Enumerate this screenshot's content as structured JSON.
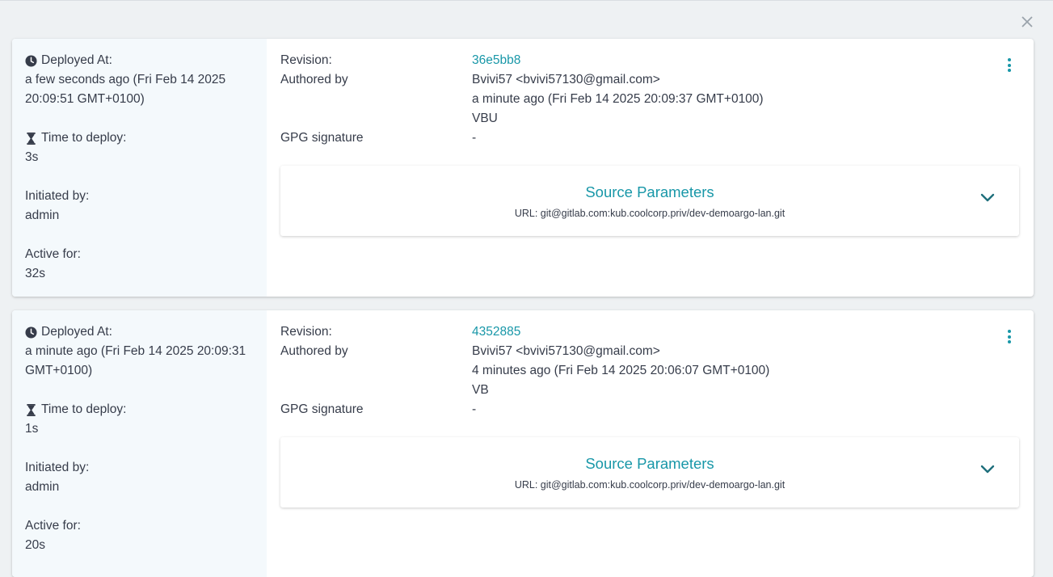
{
  "dialog": {
    "close_icon": "close-icon"
  },
  "labels": {
    "deployed_at": "Deployed At:",
    "time_to_deploy": "Time to deploy:",
    "initiated_by": "Initiated by:",
    "active_for": "Active for:",
    "revision": "Revision:",
    "authored_by": "Authored by",
    "gpg_signature": "GPG signature",
    "source_parameters": "Source Parameters"
  },
  "deployments": [
    {
      "deployed_at_line1": "a few seconds ago (Fri Feb 14 2025",
      "deployed_at_line2": "20:09:51 GMT+0100)",
      "time_to_deploy": "3s",
      "initiated_by": "admin",
      "active_for": "32s",
      "revision": "36e5bb8",
      "author": "Bvivi57 <bvivi57130@gmail.com>",
      "authored_time": "a minute ago (Fri Feb 14 2025 20:09:37 GMT+0100)",
      "commit_message": "VBU",
      "gpg_signature": "-",
      "source_url": "URL: git@gitlab.com:kub.coolcorp.priv/dev-demoargo-lan.git"
    },
    {
      "deployed_at_line1": "a minute ago (Fri Feb 14 2025 20:09:31",
      "deployed_at_line2": "GMT+0100)",
      "time_to_deploy": "1s",
      "initiated_by": "admin",
      "active_for": "20s",
      "revision": "4352885",
      "author": "Bvivi57 <bvivi57130@gmail.com>",
      "authored_time": "4 minutes ago (Fri Feb 14 2025 20:06:07 GMT+0100)",
      "commit_message": "VB",
      "gpg_signature": "-",
      "source_url": "URL: git@gitlab.com:kub.coolcorp.priv/dev-demoargo-lan.git"
    }
  ],
  "colors": {
    "accent": "#1897a8",
    "text": "#363c4a",
    "left_panel_bg": "#f4f9fc",
    "page_bg": "#eef1f3"
  }
}
